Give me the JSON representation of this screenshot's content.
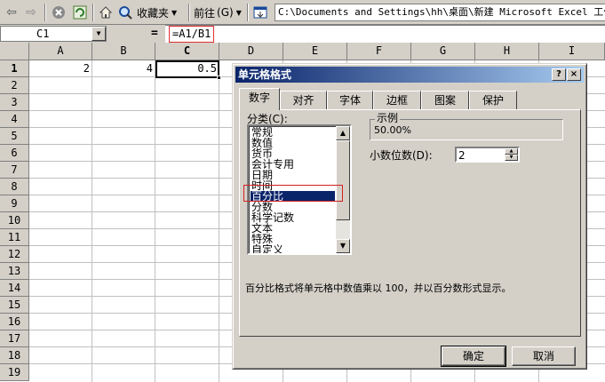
{
  "toolbar": {
    "favorites_label": "收藏夹",
    "goto_label": "前往",
    "goto_shortcut": "(G)",
    "address": "C:\\Documents and Settings\\hh\\桌面\\新建 Microsoft Excel 工作表"
  },
  "formula_bar": {
    "name_box": "C1",
    "equals": "=",
    "formula": "=A1/B1"
  },
  "sheet": {
    "columns": [
      "A",
      "B",
      "C",
      "D",
      "E",
      "F",
      "G",
      "H",
      "I"
    ],
    "rows": [
      "1",
      "2",
      "3",
      "4",
      "5",
      "6",
      "7",
      "8",
      "9",
      "10",
      "11",
      "12",
      "13",
      "14",
      "15",
      "16",
      "17",
      "18",
      "19"
    ],
    "cells": {
      "A1": "2",
      "B1": "4",
      "C1": "0.5"
    },
    "selected_cell": "C1"
  },
  "dialog": {
    "title": "单元格格式",
    "help_btn": "?",
    "close_btn": "×",
    "tabs": [
      "数字",
      "对齐",
      "字体",
      "边框",
      "图案",
      "保护"
    ],
    "active_tab": "数字",
    "category_label": "分类(C):",
    "categories": [
      "常规",
      "数值",
      "货币",
      "会计专用",
      "日期",
      "时间",
      "百分比",
      "分数",
      "科学记数",
      "文本",
      "特殊",
      "自定义"
    ],
    "selected_category": "百分比",
    "sample_label": "示例",
    "sample_value": "50.00%",
    "decimals_label": "小数位数(D):",
    "decimals_value": "2",
    "description": "百分比格式将单元格中数值乘以 100，并以百分数形式显示。",
    "ok_label": "确定",
    "cancel_label": "取消"
  },
  "colors": {
    "titlebar_start": "#0a246a",
    "titlebar_end": "#a6caf0",
    "selection": "#0a246a",
    "highlight_box": "#d42020"
  }
}
